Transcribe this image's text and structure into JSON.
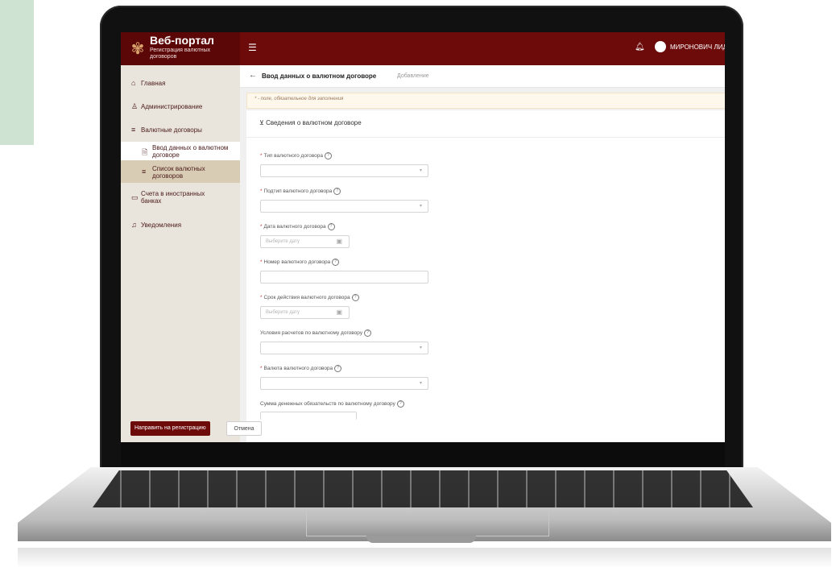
{
  "app": {
    "title": "Веб-портал",
    "subtitle": "Регистрация валютных договоров",
    "logo_icon": "monogram-logo",
    "menu_icon": "hamburger-icon",
    "bell_icon": "bell-icon",
    "user": "МИРОНОВИЧ ЛИДИЯ",
    "colors": {
      "primary": "#6d0b0b",
      "sidebar": "#eae5dc",
      "sidebar_highlight": "#d9ccb5",
      "required": "#cc3333"
    }
  },
  "sidebar": {
    "items": [
      {
        "label": "Главная",
        "icon": "home-icon"
      },
      {
        "label": "Администрирование",
        "icon": "user-icon"
      },
      {
        "label": "Валютные договоры",
        "icon": "list-icon"
      },
      {
        "label": "Ввод данных о валютном договоре",
        "icon": "document-icon"
      },
      {
        "label": "Список валютных договоров",
        "icon": "list-icon"
      },
      {
        "label": "Счета в иностранных банках",
        "icon": "card-icon"
      },
      {
        "label": "Уведомления",
        "icon": "bell-icon"
      }
    ]
  },
  "page": {
    "title": "Ввод данных о валютном договоре",
    "subtitle": "Добавление",
    "notice": "* - поле, обязательное для заполнения",
    "section": "Сведения о валютном договоре"
  },
  "fields": [
    {
      "label": "Тип валютного договора",
      "required": true,
      "type": "select"
    },
    {
      "label": "Подтип валютного договора",
      "required": true,
      "type": "select"
    },
    {
      "label": "Дата валютного договора",
      "required": true,
      "type": "date",
      "placeholder": "Выберите дату"
    },
    {
      "label": "Номер валютного договора",
      "required": true,
      "type": "input"
    },
    {
      "label": "Срок действия валютного договора",
      "required": true,
      "type": "date",
      "placeholder": "Выберите дату"
    },
    {
      "label": "Условия расчетов по валютному договору",
      "required": false,
      "type": "select"
    },
    {
      "label": "Валюта валютного договора",
      "required": true,
      "type": "select"
    },
    {
      "label": "Сумма денежных обязательств по валютному договору",
      "required": false,
      "type": "input"
    }
  ],
  "buttons": {
    "submit": "Направить на регистрацию",
    "cancel": "Отмена"
  }
}
